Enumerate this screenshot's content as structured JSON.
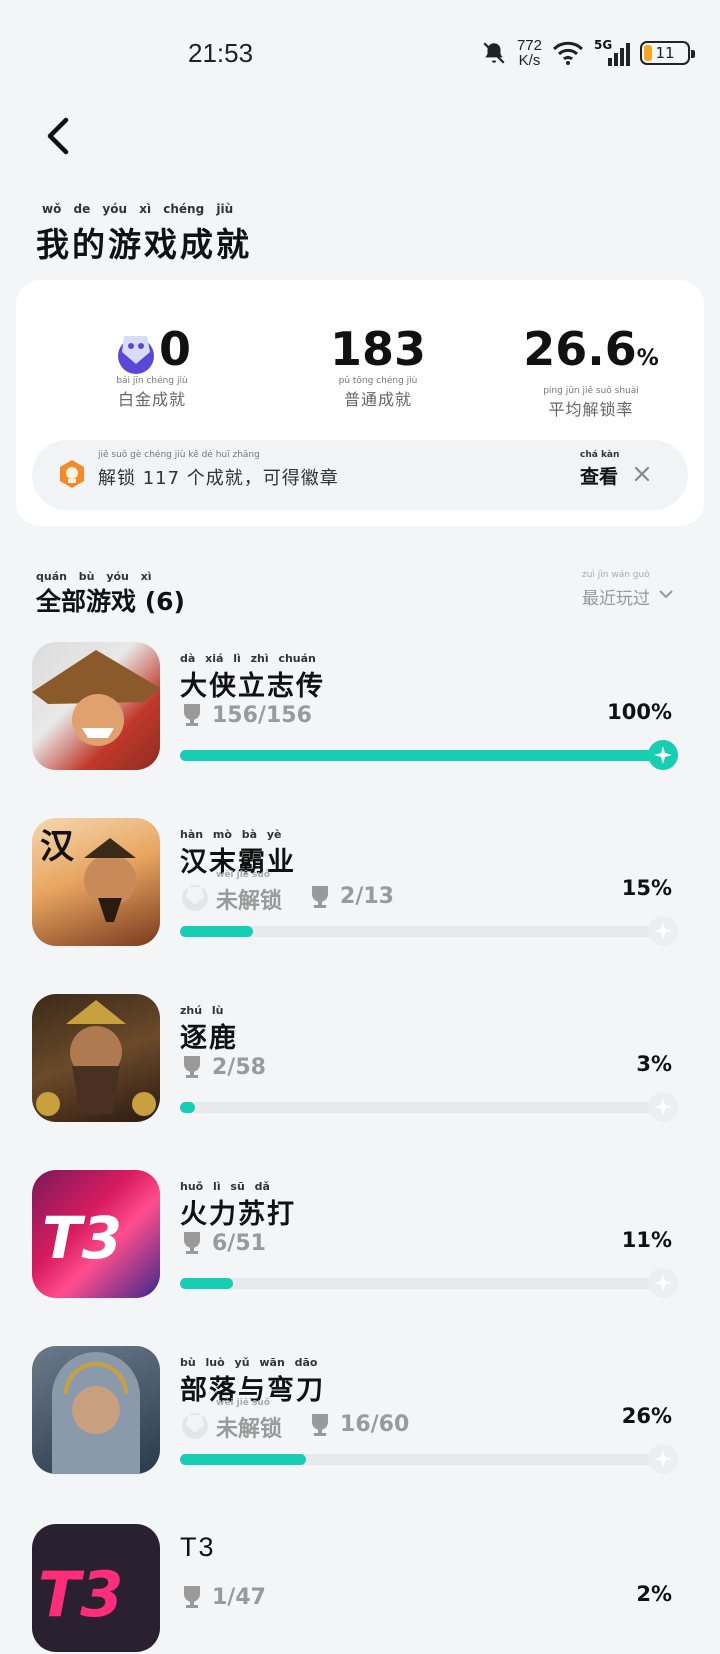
{
  "status": {
    "time": "21:53",
    "speed_top": "772",
    "speed_bottom": "K/s",
    "network": "5G",
    "battery": "11"
  },
  "header": {
    "title": "我的游戏成就",
    "title_pinyin": "wǒ de yóu xì chéng jiù"
  },
  "summary": {
    "platinum_value": "0",
    "platinum_label": "白金成就",
    "platinum_pinyin": "bái jīn chéng jiù",
    "normal_value": "183",
    "normal_label": "普通成就",
    "normal_pinyin": "pǔ tōng chéng jiù",
    "rate_value": "26.6",
    "rate_unit": "%",
    "rate_label": "平均解锁率",
    "rate_pinyin": "píng jūn jiě suǒ shuài",
    "banner_text": "解锁 117 个成就，可得徽章",
    "banner_pinyin": "jiě suǒ gè chéng jiù kě dé huī zhāng",
    "view_label": "查看",
    "view_pinyin": "chá kàn"
  },
  "section": {
    "title": "全部游戏 (6)",
    "title_pinyin": "quán bù yóu xì",
    "sort_label": "最近玩过",
    "sort_pinyin": "zuì jìn wán guò"
  },
  "games": [
    {
      "name": "大侠立志传",
      "pinyin": "dà xiá lì zhì chuán",
      "locked_label": "",
      "count": "156/156",
      "percent": "100%",
      "progress": 1.0
    },
    {
      "name": "汉末霸业",
      "pinyin": "hàn mò bà yè",
      "locked_label": "未解锁",
      "locked_pinyin": "wèi jiě suǒ",
      "count": "2/13",
      "percent": "15%",
      "progress": 0.15
    },
    {
      "name": "逐鹿",
      "pinyin": "zhú lù",
      "locked_label": "",
      "count": "2/58",
      "percent": "3%",
      "progress": 0.03
    },
    {
      "name": "火力苏打",
      "pinyin": "huǒ lì sū dǎ",
      "locked_label": "",
      "count": "6/51",
      "percent": "11%",
      "progress": 0.11
    },
    {
      "name": "部落与弯刀",
      "pinyin": "bù luò yǔ wān dāo",
      "locked_label": "未解锁",
      "locked_pinyin": "wèi jiě suǒ",
      "count": "16/60",
      "percent": "26%",
      "progress": 0.26
    },
    {
      "name": "T3",
      "pinyin": "",
      "locked_label": "",
      "count": "1/47",
      "percent": "2%",
      "progress": 0.02
    }
  ],
  "colors": {
    "accent": "#17cdb2",
    "background": "#f4f5f7",
    "card": "#ffffff"
  },
  "icons": [
    "back-arrow-icon",
    "bell-off-icon",
    "wifi-icon",
    "signal-icon",
    "battery-icon",
    "platinum-trophy-icon",
    "badge-icon",
    "close-icon",
    "chevron-down-icon",
    "trophy-icon",
    "star-icon"
  ]
}
